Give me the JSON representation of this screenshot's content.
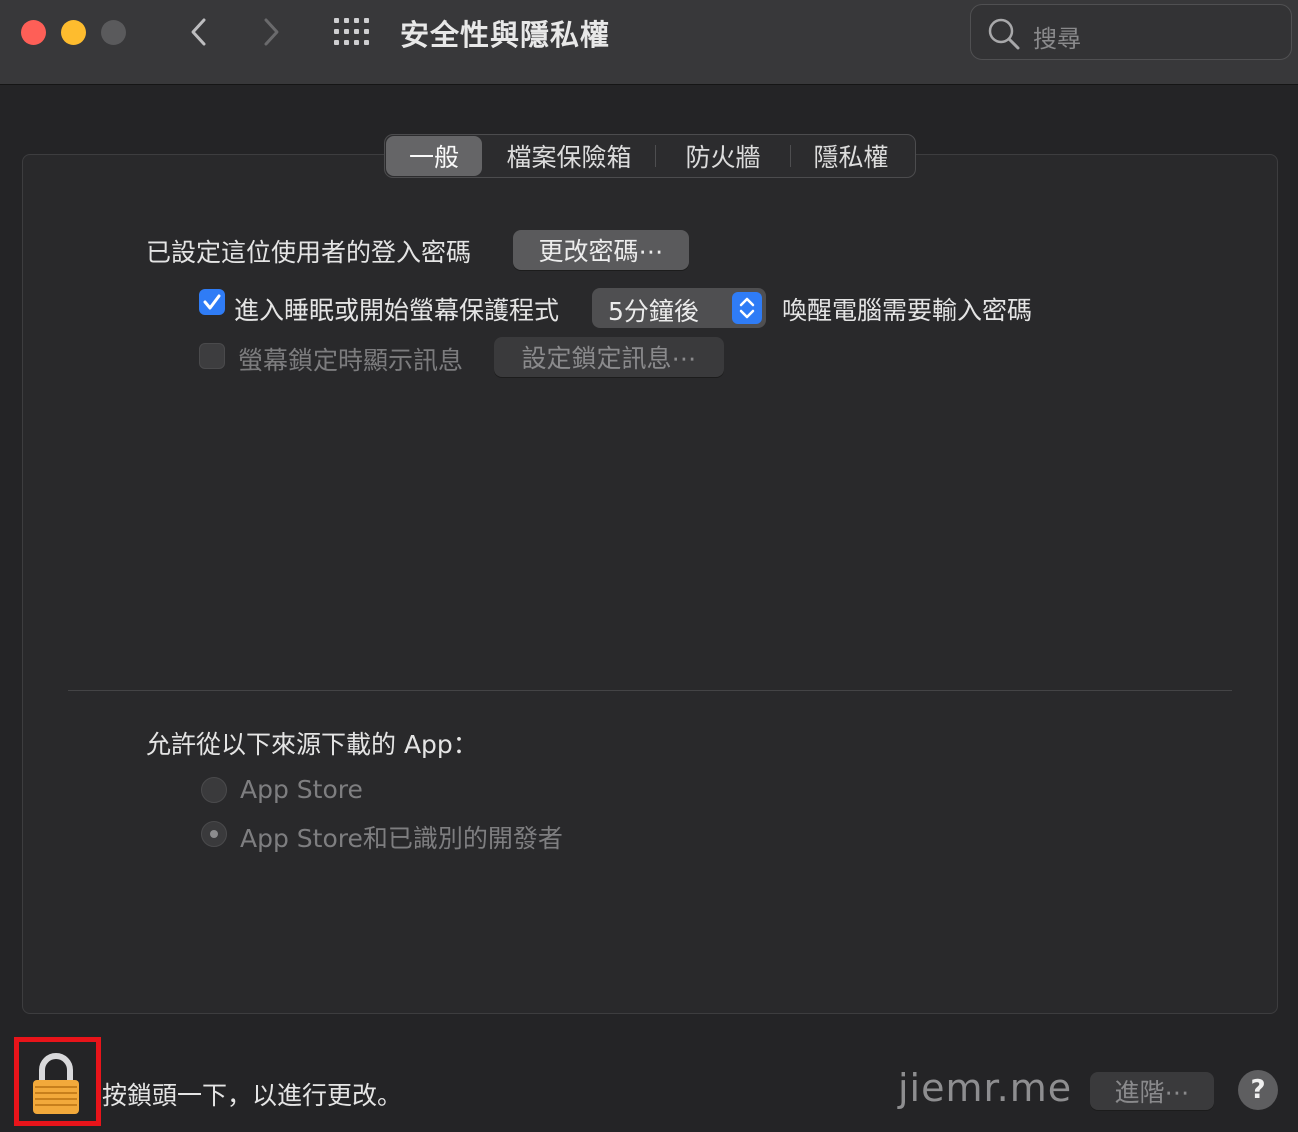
{
  "window": {
    "title": "安全性與隱私權",
    "search_placeholder": "搜尋"
  },
  "tabs": [
    {
      "label": "一般",
      "selected": true
    },
    {
      "label": "檔案保險箱",
      "selected": false
    },
    {
      "label": "防火牆",
      "selected": false
    },
    {
      "label": "隱私權",
      "selected": false
    }
  ],
  "general": {
    "password_label": "已設定這位使用者的登入密碼",
    "change_password_button": "更改密碼⋯",
    "require_password_label": "進入睡眠或開始螢幕保護程式",
    "require_password_checked": true,
    "delay_value": "5分鐘後",
    "require_password_suffix": "喚醒電腦需要輸入密碼",
    "lock_message_label": "螢幕鎖定時顯示訊息",
    "lock_message_checked": false,
    "set_lock_message_button": "設定鎖定訊息⋯"
  },
  "downloads": {
    "label": "允許從以下來源下載的 App：",
    "options": [
      {
        "label": "App Store",
        "selected": false
      },
      {
        "label": "App Store和已識別的開發者",
        "selected": true
      }
    ]
  },
  "footer": {
    "lock_text": "按鎖頭一下，以進行更改。",
    "watermark": "jiemr.me",
    "advanced_button": "進階⋯",
    "help_label": "?"
  },
  "colors": {
    "accent": "#2f7cf6",
    "highlight_box": "#e8141a"
  }
}
